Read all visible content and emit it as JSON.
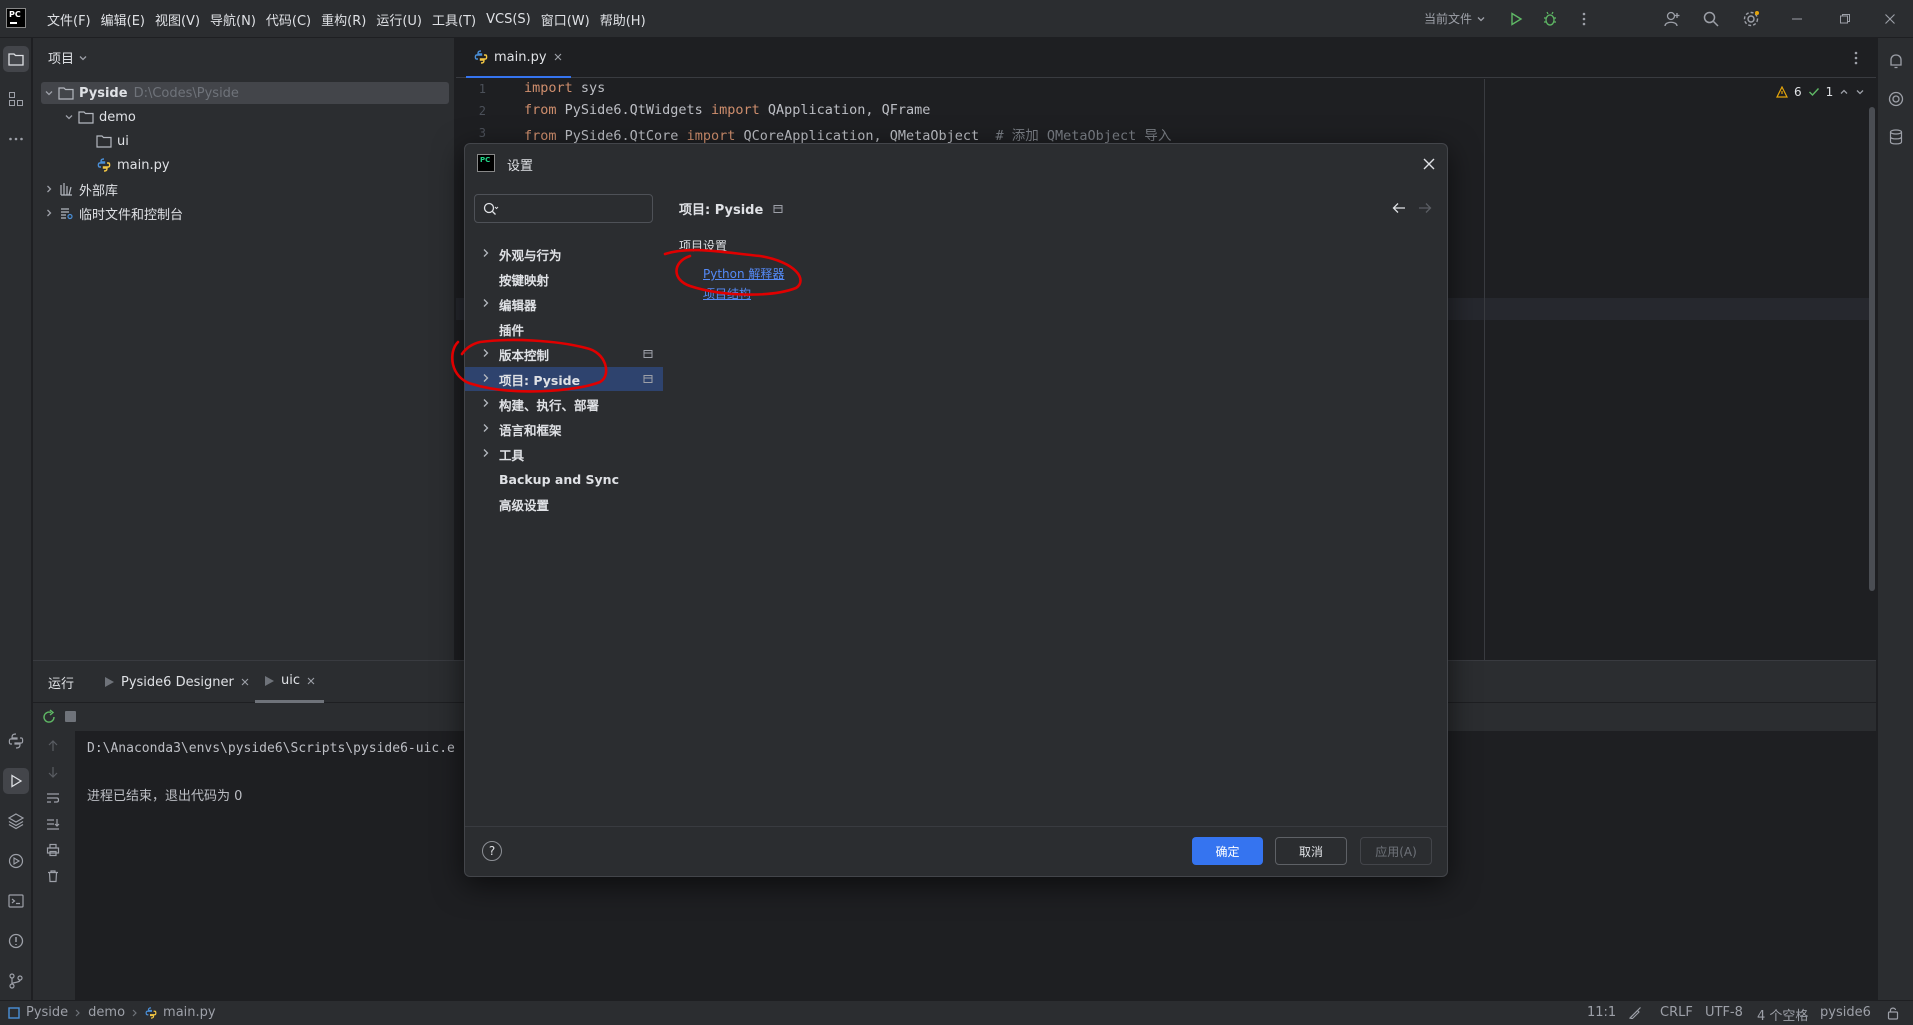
{
  "titlebar": {
    "menu": [
      "文件(F)",
      "编辑(E)",
      "视图(V)",
      "导航(N)",
      "代码(C)",
      "重构(R)",
      "运行(U)",
      "工具(T)",
      "VCS(S)",
      "窗口(W)",
      "帮助(H)"
    ],
    "run_config": "当前文件"
  },
  "project": {
    "header": "项目",
    "tree": [
      {
        "label": "Pyside",
        "path": "D:\\Codes\\Pyside"
      },
      {
        "label": "demo"
      },
      {
        "label": "ui"
      },
      {
        "label": "main.py"
      },
      {
        "label": "外部库"
      },
      {
        "label": "临时文件和控制台"
      }
    ]
  },
  "editor": {
    "tab": "main.py",
    "lines": [
      {
        "num": "1",
        "parts": [
          {
            "t": "import",
            "c": "kw"
          },
          {
            "t": " sys",
            "c": ""
          }
        ]
      },
      {
        "num": "2",
        "parts": [
          {
            "t": "from",
            "c": "kw"
          },
          {
            "t": " PySide6.QtWidgets ",
            "c": ""
          },
          {
            "t": "import",
            "c": "kw"
          },
          {
            "t": " QApplication, QFrame",
            "c": ""
          }
        ]
      },
      {
        "num": "3",
        "parts": [
          {
            "t": "from",
            "c": "kw"
          },
          {
            "t": " PySide6.QtCore ",
            "c": ""
          },
          {
            "t": "import",
            "c": "kw"
          },
          {
            "t": " QCoreApplication, QMetaObject  ",
            "c": ""
          },
          {
            "t": "# 添加 QMetaObject 导入",
            "c": "cm"
          }
        ]
      }
    ],
    "warnings": "6",
    "checks": "1"
  },
  "run": {
    "title": "运行",
    "tabs": [
      "Pyside6 Designer",
      "uic"
    ],
    "console": [
      "D:\\Anaconda3\\envs\\pyside6\\Scripts\\pyside6-uic.e",
      "进程已结束，退出代码为 0"
    ]
  },
  "status": {
    "crumbs": [
      "Pyside",
      "demo",
      "main.py"
    ],
    "position": "11:1",
    "line_sep": "CRLF",
    "encoding": "UTF-8",
    "indent": "4 个空格",
    "interpreter": "pyside6"
  },
  "dialog": {
    "title": "设置",
    "search_placeholder": "",
    "nav": [
      {
        "label": "外观与行为",
        "arrow": true,
        "badge": false
      },
      {
        "label": "按键映射",
        "arrow": false,
        "badge": false
      },
      {
        "label": "编辑器",
        "arrow": true,
        "badge": false
      },
      {
        "label": "插件",
        "arrow": false,
        "badge": false
      },
      {
        "label": "版本控制",
        "arrow": true,
        "badge": true
      },
      {
        "label": "项目: Pyside",
        "arrow": true,
        "badge": true
      },
      {
        "label": "构建、执行、部署",
        "arrow": true,
        "badge": false
      },
      {
        "label": "语言和框架",
        "arrow": true,
        "badge": false
      },
      {
        "label": "工具",
        "arrow": true,
        "badge": false
      },
      {
        "label": "Backup and Sync",
        "arrow": false,
        "badge": false
      },
      {
        "label": "高级设置",
        "arrow": false,
        "badge": false
      }
    ],
    "content_title": "项目: Pyside",
    "section": "项目设置",
    "links": [
      "Python 解释器",
      "项目结构"
    ],
    "buttons": {
      "help": "?",
      "ok": "确定",
      "cancel": "取消",
      "apply": "应用(A)"
    }
  },
  "colors": {
    "accent": "#3574f0",
    "link": "#548af7",
    "annotation": "#e00000",
    "selection": "#2e436e"
  }
}
